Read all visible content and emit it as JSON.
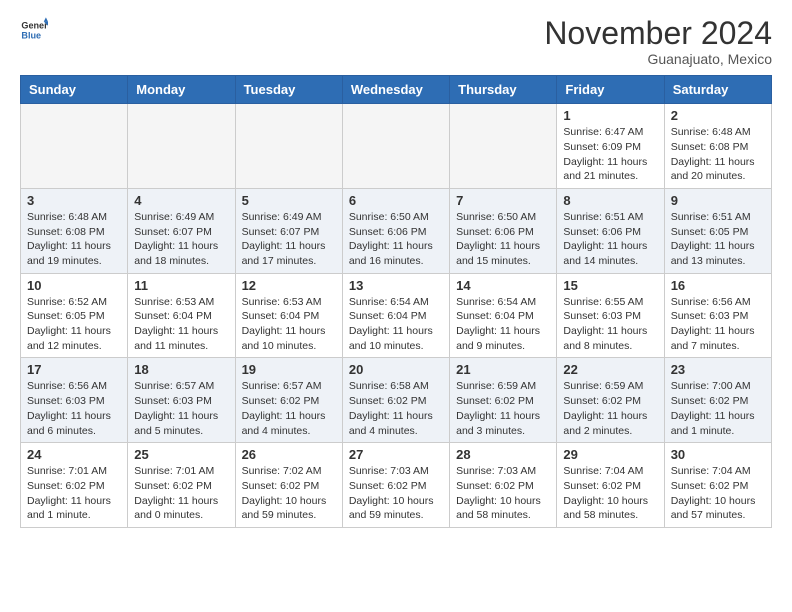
{
  "header": {
    "logo_general": "General",
    "logo_blue": "Blue",
    "month_title": "November 2024",
    "subtitle": "Guanajuato, Mexico"
  },
  "days_of_week": [
    "Sunday",
    "Monday",
    "Tuesday",
    "Wednesday",
    "Thursday",
    "Friday",
    "Saturday"
  ],
  "weeks": [
    [
      {
        "day": "",
        "empty": true
      },
      {
        "day": "",
        "empty": true
      },
      {
        "day": "",
        "empty": true
      },
      {
        "day": "",
        "empty": true
      },
      {
        "day": "",
        "empty": true
      },
      {
        "day": "1",
        "sunrise": "Sunrise: 6:47 AM",
        "sunset": "Sunset: 6:09 PM",
        "daylight": "Daylight: 11 hours and 21 minutes."
      },
      {
        "day": "2",
        "sunrise": "Sunrise: 6:48 AM",
        "sunset": "Sunset: 6:08 PM",
        "daylight": "Daylight: 11 hours and 20 minutes."
      }
    ],
    [
      {
        "day": "3",
        "sunrise": "Sunrise: 6:48 AM",
        "sunset": "Sunset: 6:08 PM",
        "daylight": "Daylight: 11 hours and 19 minutes."
      },
      {
        "day": "4",
        "sunrise": "Sunrise: 6:49 AM",
        "sunset": "Sunset: 6:07 PM",
        "daylight": "Daylight: 11 hours and 18 minutes."
      },
      {
        "day": "5",
        "sunrise": "Sunrise: 6:49 AM",
        "sunset": "Sunset: 6:07 PM",
        "daylight": "Daylight: 11 hours and 17 minutes."
      },
      {
        "day": "6",
        "sunrise": "Sunrise: 6:50 AM",
        "sunset": "Sunset: 6:06 PM",
        "daylight": "Daylight: 11 hours and 16 minutes."
      },
      {
        "day": "7",
        "sunrise": "Sunrise: 6:50 AM",
        "sunset": "Sunset: 6:06 PM",
        "daylight": "Daylight: 11 hours and 15 minutes."
      },
      {
        "day": "8",
        "sunrise": "Sunrise: 6:51 AM",
        "sunset": "Sunset: 6:06 PM",
        "daylight": "Daylight: 11 hours and 14 minutes."
      },
      {
        "day": "9",
        "sunrise": "Sunrise: 6:51 AM",
        "sunset": "Sunset: 6:05 PM",
        "daylight": "Daylight: 11 hours and 13 minutes."
      }
    ],
    [
      {
        "day": "10",
        "sunrise": "Sunrise: 6:52 AM",
        "sunset": "Sunset: 6:05 PM",
        "daylight": "Daylight: 11 hours and 12 minutes."
      },
      {
        "day": "11",
        "sunrise": "Sunrise: 6:53 AM",
        "sunset": "Sunset: 6:04 PM",
        "daylight": "Daylight: 11 hours and 11 minutes."
      },
      {
        "day": "12",
        "sunrise": "Sunrise: 6:53 AM",
        "sunset": "Sunset: 6:04 PM",
        "daylight": "Daylight: 11 hours and 10 minutes."
      },
      {
        "day": "13",
        "sunrise": "Sunrise: 6:54 AM",
        "sunset": "Sunset: 6:04 PM",
        "daylight": "Daylight: 11 hours and 10 minutes."
      },
      {
        "day": "14",
        "sunrise": "Sunrise: 6:54 AM",
        "sunset": "Sunset: 6:04 PM",
        "daylight": "Daylight: 11 hours and 9 minutes."
      },
      {
        "day": "15",
        "sunrise": "Sunrise: 6:55 AM",
        "sunset": "Sunset: 6:03 PM",
        "daylight": "Daylight: 11 hours and 8 minutes."
      },
      {
        "day": "16",
        "sunrise": "Sunrise: 6:56 AM",
        "sunset": "Sunset: 6:03 PM",
        "daylight": "Daylight: 11 hours and 7 minutes."
      }
    ],
    [
      {
        "day": "17",
        "sunrise": "Sunrise: 6:56 AM",
        "sunset": "Sunset: 6:03 PM",
        "daylight": "Daylight: 11 hours and 6 minutes."
      },
      {
        "day": "18",
        "sunrise": "Sunrise: 6:57 AM",
        "sunset": "Sunset: 6:03 PM",
        "daylight": "Daylight: 11 hours and 5 minutes."
      },
      {
        "day": "19",
        "sunrise": "Sunrise: 6:57 AM",
        "sunset": "Sunset: 6:02 PM",
        "daylight": "Daylight: 11 hours and 4 minutes."
      },
      {
        "day": "20",
        "sunrise": "Sunrise: 6:58 AM",
        "sunset": "Sunset: 6:02 PM",
        "daylight": "Daylight: 11 hours and 4 minutes."
      },
      {
        "day": "21",
        "sunrise": "Sunrise: 6:59 AM",
        "sunset": "Sunset: 6:02 PM",
        "daylight": "Daylight: 11 hours and 3 minutes."
      },
      {
        "day": "22",
        "sunrise": "Sunrise: 6:59 AM",
        "sunset": "Sunset: 6:02 PM",
        "daylight": "Daylight: 11 hours and 2 minutes."
      },
      {
        "day": "23",
        "sunrise": "Sunrise: 7:00 AM",
        "sunset": "Sunset: 6:02 PM",
        "daylight": "Daylight: 11 hours and 1 minute."
      }
    ],
    [
      {
        "day": "24",
        "sunrise": "Sunrise: 7:01 AM",
        "sunset": "Sunset: 6:02 PM",
        "daylight": "Daylight: 11 hours and 1 minute."
      },
      {
        "day": "25",
        "sunrise": "Sunrise: 7:01 AM",
        "sunset": "Sunset: 6:02 PM",
        "daylight": "Daylight: 11 hours and 0 minutes."
      },
      {
        "day": "26",
        "sunrise": "Sunrise: 7:02 AM",
        "sunset": "Sunset: 6:02 PM",
        "daylight": "Daylight: 10 hours and 59 minutes."
      },
      {
        "day": "27",
        "sunrise": "Sunrise: 7:03 AM",
        "sunset": "Sunset: 6:02 PM",
        "daylight": "Daylight: 10 hours and 59 minutes."
      },
      {
        "day": "28",
        "sunrise": "Sunrise: 7:03 AM",
        "sunset": "Sunset: 6:02 PM",
        "daylight": "Daylight: 10 hours and 58 minutes."
      },
      {
        "day": "29",
        "sunrise": "Sunrise: 7:04 AM",
        "sunset": "Sunset: 6:02 PM",
        "daylight": "Daylight: 10 hours and 58 minutes."
      },
      {
        "day": "30",
        "sunrise": "Sunrise: 7:04 AM",
        "sunset": "Sunset: 6:02 PM",
        "daylight": "Daylight: 10 hours and 57 minutes."
      }
    ]
  ]
}
